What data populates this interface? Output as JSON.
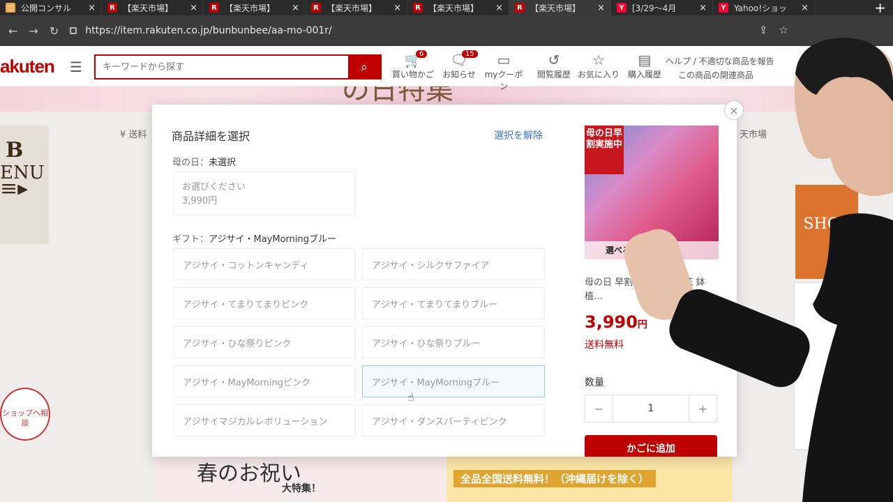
{
  "browser": {
    "tabs": [
      {
        "label": "公開コンサル",
        "icon": "calendar-icon",
        "color": "#f0a64a"
      },
      {
        "label": "【楽天市場】",
        "icon": "rakuten-icon",
        "color": "#bf0000"
      },
      {
        "label": "【楽天市場】",
        "icon": "rakuten-icon",
        "color": "#bf0000"
      },
      {
        "label": "【楽天市場】",
        "icon": "rakuten-icon",
        "color": "#bf0000"
      },
      {
        "label": "【楽天市場】",
        "icon": "rakuten-icon",
        "color": "#bf0000"
      },
      {
        "label": "【楽天市場】 ",
        "icon": "rakuten-icon",
        "color": "#bf0000"
      },
      {
        "label": "[3/29〜4月",
        "icon": "yahoo-icon",
        "color": "#ff0033"
      },
      {
        "label": "Yahoo!ショッ",
        "icon": "yahoo-icon",
        "color": "#ff0033"
      }
    ],
    "url": "https://item.rakuten.co.jp/bunbunbee/aa-mo-001r/"
  },
  "header": {
    "logo": "akuten",
    "search_placeholder": "キーワードから探す",
    "icons": [
      {
        "label": "買い物かご",
        "badge": "6",
        "icon": "cart-icon"
      },
      {
        "label": "お知らせ",
        "badge": "15",
        "icon": "bell-icon"
      },
      {
        "label": "myクーポン",
        "badge": "",
        "icon": "coupon-icon"
      },
      {
        "label": "閲覧履歴",
        "badge": "",
        "icon": "history-icon"
      },
      {
        "label": "お気に入り",
        "badge": "",
        "icon": "star-icon"
      },
      {
        "label": "購入履歴",
        "badge": "",
        "icon": "receipt-icon"
      }
    ],
    "help_line1": "ヘルプ / 不適切な商品を報告",
    "help_line2": "この商品の関連商品"
  },
  "background": {
    "banner_title": "の日特集",
    "left_menu": "ENU",
    "chat_button": "ショップへ相談",
    "bottom_left": "春のお祝い",
    "bottom_left_sub": "大特集！",
    "bottom_right": "全品全国送料無料！（沖縄届けを除く）",
    "right_shop": "SHOP",
    "top_left_text": "¥ 送料",
    "top_right_text": "天市場"
  },
  "modal": {
    "title": "商品詳細を選択",
    "clear_label": "選択を解除",
    "mother_label": "母の日：",
    "mother_value": "未選択",
    "mother_option_line1": "お選びください",
    "mother_option_line2": "3,990円",
    "gift_label": "ギフト：",
    "gift_value": "アジサイ・MayMorningブルー",
    "options": [
      "アジサイ・コットンキャンディ",
      "アジサイ・シルクサファイア",
      "アジサイ・てまりてまりピンク",
      "アジサイ・てまりてまりブルー",
      "アジサイ・ひな祭りピンク",
      "アジサイ・ひな祭りブルー",
      "アジサイ・MayMorningピンク",
      "アジサイ・MayMorningブルー",
      "アジサイマジカルレボリューション",
      "アジサイ・ダンスパーティピンク"
    ],
    "selected_index": 7,
    "product": {
      "ribbon": "母の日早割実施中",
      "image_caption": "選べる2",
      "name": "母の日 早割 プレゼント 花 鉢植…",
      "price": "3,990",
      "price_unit": "円",
      "shipping": "送料無料",
      "qty_label": "数量",
      "qty_value": "1",
      "cart_button": "かごに追加"
    }
  }
}
